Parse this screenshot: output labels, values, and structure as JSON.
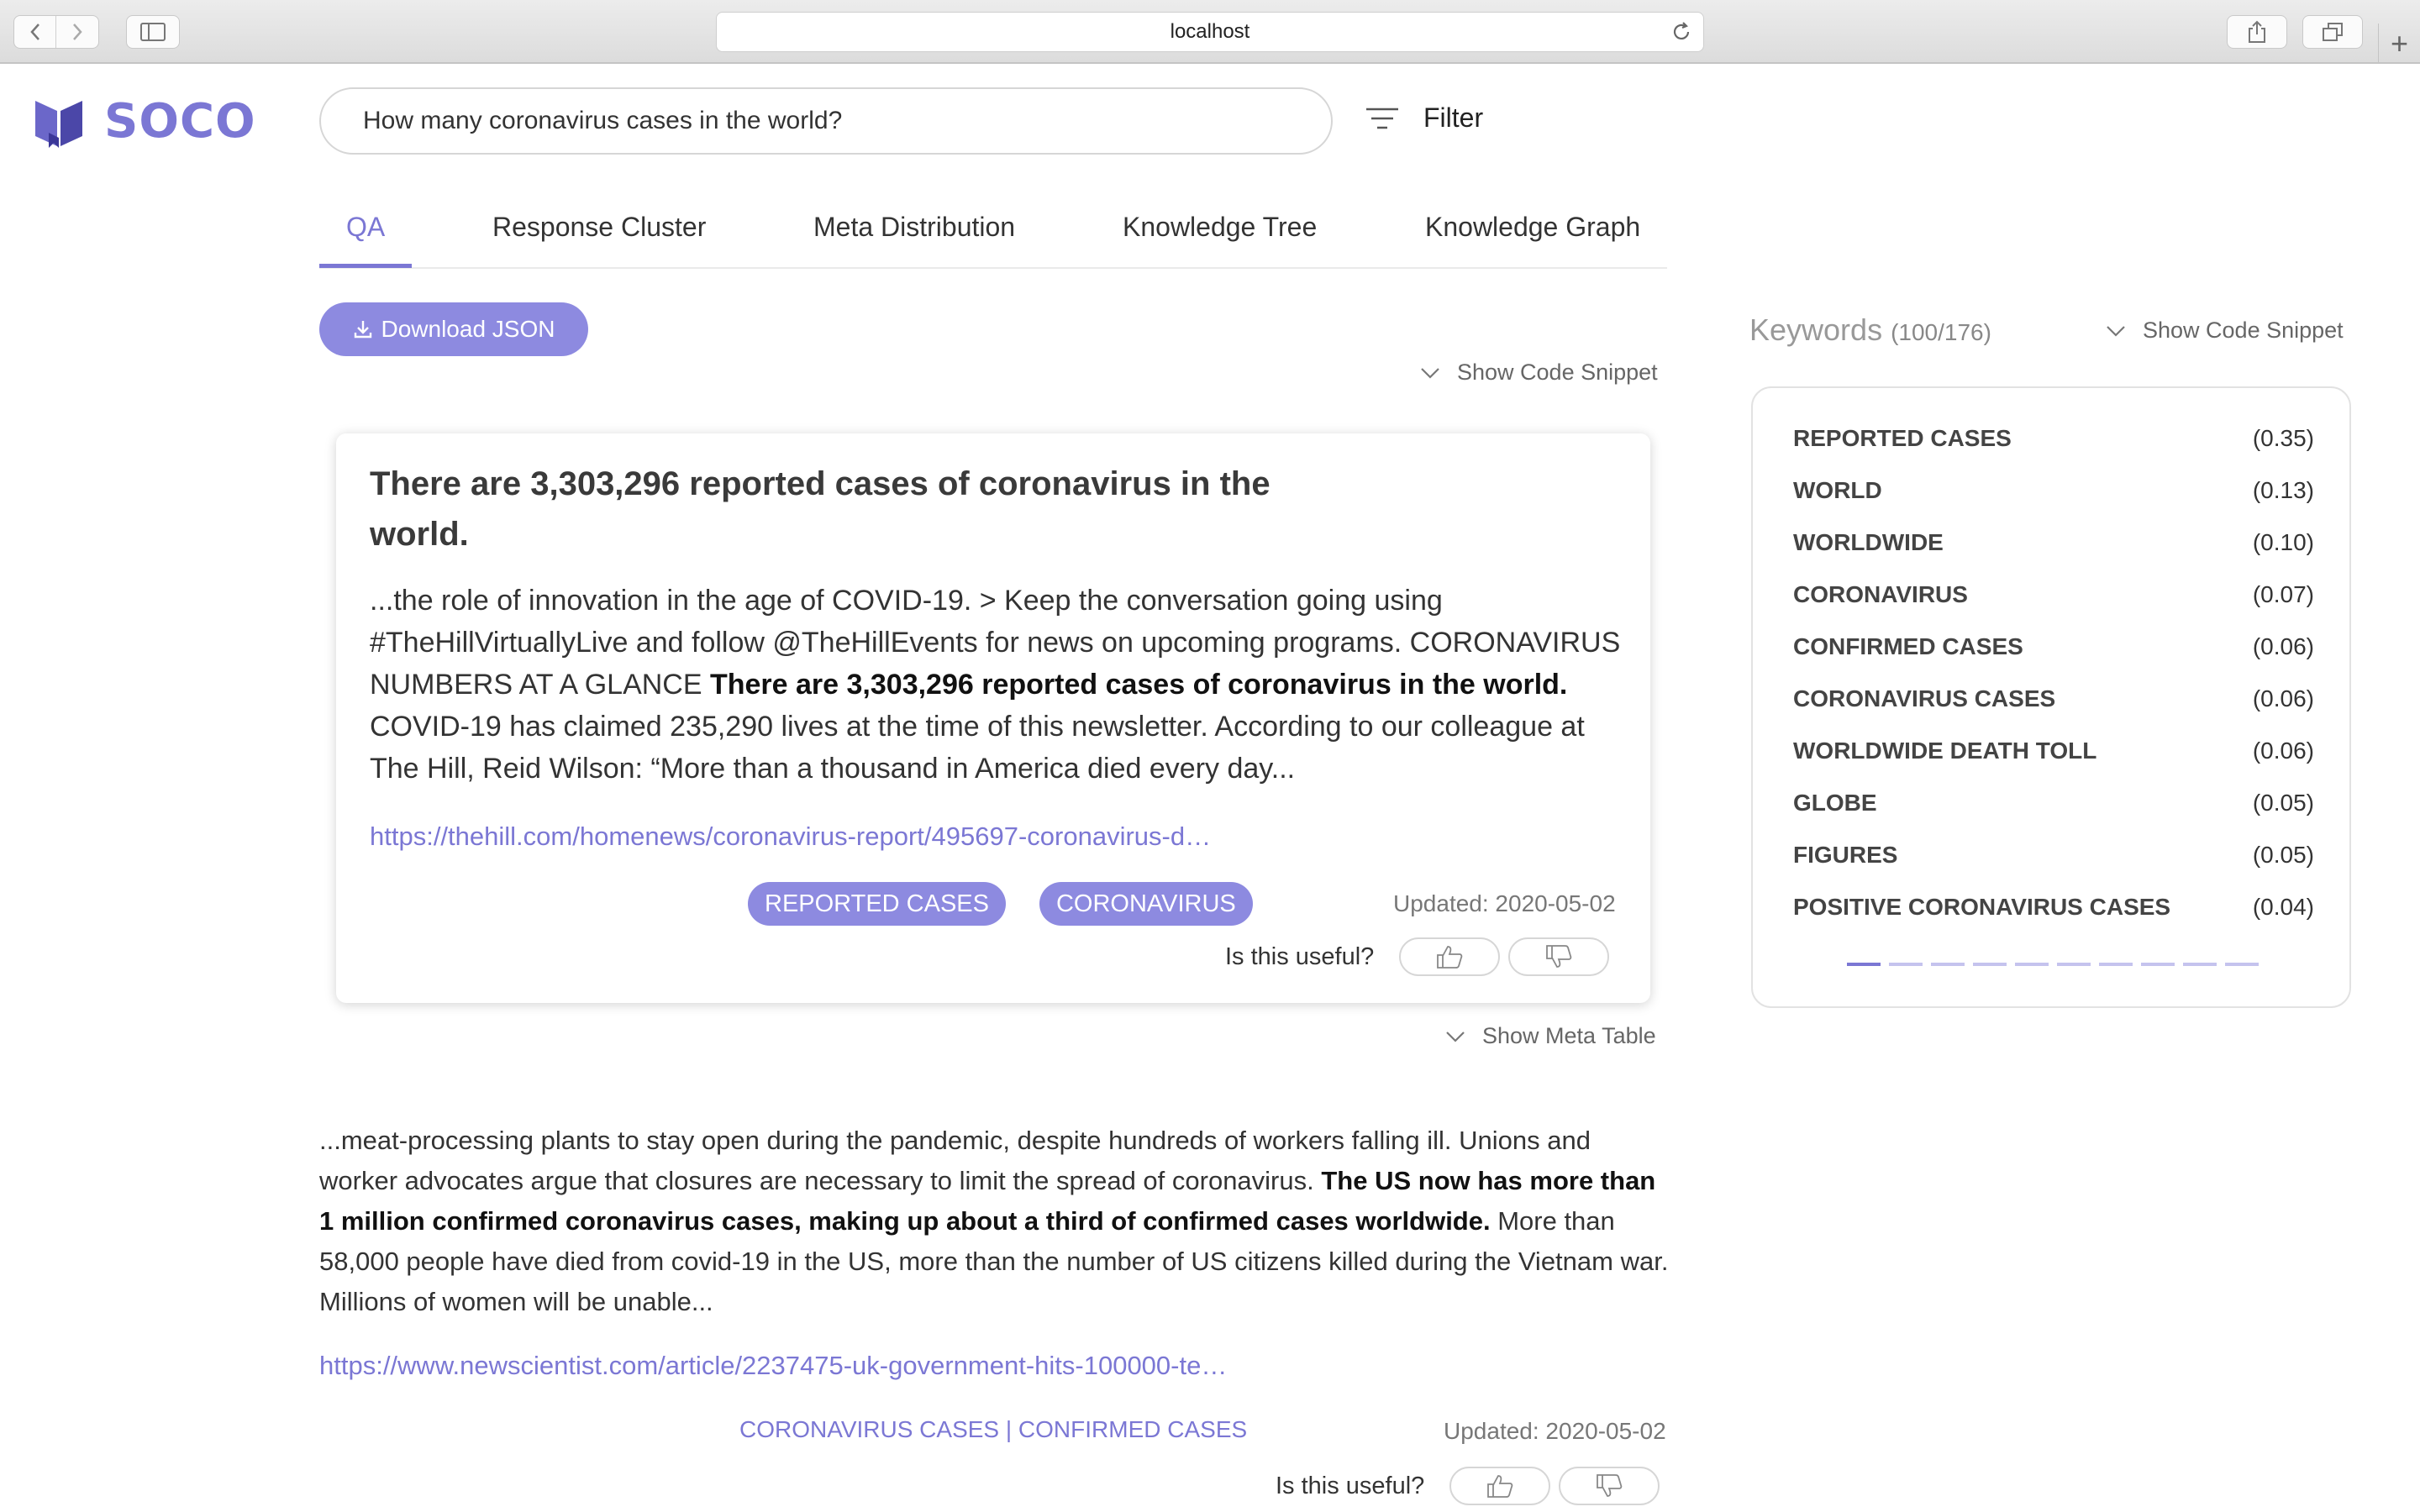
{
  "browser": {
    "url": "localhost"
  },
  "app": {
    "logo_text": "SOCO"
  },
  "search": {
    "query": "How many coronavirus cases in the world?"
  },
  "filter": {
    "label": "Filter"
  },
  "tabs": [
    {
      "label": "QA",
      "active": true
    },
    {
      "label": "Response Cluster"
    },
    {
      "label": "Meta Distribution"
    },
    {
      "label": "Knowledge Tree"
    },
    {
      "label": "Knowledge Graph"
    }
  ],
  "download": {
    "label": "Download JSON"
  },
  "show_code_snippet": "Show Code Snippet",
  "answer_card": {
    "title": "There are 3,303,296 reported cases of coronavirus in the world.",
    "body_before": "...the role of innovation in the age of COVID-19. > Keep the conversation going using #TheHillVirtuallyLive and follow @TheHillEvents for news on upcoming programs. CORONAVIRUS NUMBERS AT A GLANCE ",
    "body_bold": "There are 3,303,296 reported cases of coronavirus in the world.",
    "body_after": " COVID-19 has claimed 235,290 lives at the time of this newsletter. According to our colleague at The Hill, Reid Wilson: “More than a thousand in America died every day...",
    "link": "https://thehill.com/homenews/coronavirus-report/495697-coronavirus-d…",
    "tags": [
      "REPORTED CASES",
      "CORONAVIRUS"
    ],
    "updated": "Updated: 2020-05-02",
    "useful_label": "Is this useful?"
  },
  "meta_toggle": "Show Meta Table",
  "result2": {
    "body_before": "...meat-processing plants to stay open during the pandemic, despite hundreds of workers falling ill. Unions and worker advocates argue that closures are necessary to limit the spread of coronavirus. ",
    "body_bold": "The US now has more than 1 million confirmed coronavirus cases, making up about a third of confirmed cases worldwide.",
    "body_after": " More than 58,000 people have died from covid-19 in the US, more than the number of US citizens killed during the Vietnam war. Millions of women will be unable...",
    "link": "https://www.newscientist.com/article/2237475-uk-government-hits-100000-te…",
    "tags_line": "CORONAVIRUS CASES | CONFIRMED CASES",
    "updated": "Updated: 2020-05-02",
    "useful_label": "Is this useful?"
  },
  "keywords": {
    "title": "Keywords",
    "count": "(100/176)",
    "show_code_snippet": "Show Code Snippet",
    "items": [
      {
        "name": "REPORTED CASES",
        "score": "(0.35)"
      },
      {
        "name": "WORLD",
        "score": "(0.13)"
      },
      {
        "name": "WORLDWIDE",
        "score": "(0.10)"
      },
      {
        "name": "CORONAVIRUS",
        "score": "(0.07)"
      },
      {
        "name": "CONFIRMED CASES",
        "score": "(0.06)"
      },
      {
        "name": "CORONAVIRUS CASES",
        "score": "(0.06)"
      },
      {
        "name": "WORLDWIDE DEATH TOLL",
        "score": "(0.06)"
      },
      {
        "name": "GLOBE",
        "score": "(0.05)"
      },
      {
        "name": "FIGURES",
        "score": "(0.05)"
      },
      {
        "name": "POSITIVE CORONAVIRUS CASES",
        "score": "(0.04)"
      }
    ],
    "page_count": 10,
    "active_page": 1
  },
  "colors": {
    "accent": "#7b77d4",
    "accent_light": "#8d8ae0"
  }
}
